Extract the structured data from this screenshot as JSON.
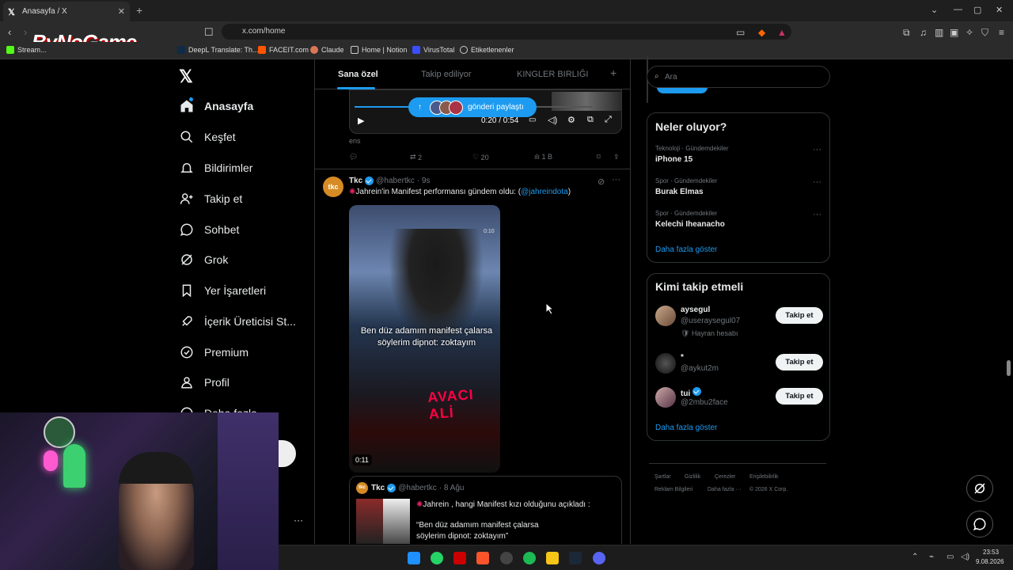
{
  "browser": {
    "tab_title": "Anasayfa / X",
    "url": "x.com/home",
    "bookmarks": [
      "Stream...",
      "DeepL Translate: Th...",
      "FACEIT.com",
      "Claude",
      "Home | Notion",
      "VirusTotal",
      "Etiketlenenler"
    ],
    "watermark": "ByNoGame"
  },
  "sidebar": {
    "items": [
      {
        "label": "Anasayfa",
        "icon": "home-icon"
      },
      {
        "label": "Keşfet",
        "icon": "search-icon"
      },
      {
        "label": "Bildirimler",
        "icon": "bell-icon"
      },
      {
        "label": "Takip et",
        "icon": "person-add-icon"
      },
      {
        "label": "Sohbet",
        "icon": "chat-icon"
      },
      {
        "label": "Grok",
        "icon": "grok-icon"
      },
      {
        "label": "Yer İşaretleri",
        "icon": "bookmark-icon"
      },
      {
        "label": "İçerik Üreticisi St...",
        "icon": "rocket-icon"
      },
      {
        "label": "Premium",
        "icon": "premium-icon"
      },
      {
        "label": "Profil",
        "icon": "profile-icon"
      },
      {
        "label": "Daha fazla",
        "icon": "more-icon"
      }
    ]
  },
  "feed": {
    "tabs": [
      "Sana özel",
      "Takip ediliyor",
      "KINGLER BIRLIĞI"
    ],
    "share_pill": "gönderi paylaştı",
    "video1_time": "0:20 / 0:54",
    "video1_caption": "ens",
    "video1_stats": {
      "reply": "",
      "retweet": "2",
      "like": "20",
      "views": "1 B"
    },
    "tweet": {
      "name": "Tkc",
      "handle": "@habertkc",
      "time": "· 9s",
      "text_prefix": "Jahrein'in Manifest performansı gündem oldu: (",
      "mention": "@jahreindota",
      "text_suffix": ")",
      "video_overlay_text": "Ben düz adamım manifest çalarsa söylerim dipnot: zoktayım",
      "video_corner_time": "0:10",
      "video_duration": "0:11",
      "video_sign": "AVACI ALİ"
    },
    "quote": {
      "name": "Tkc",
      "handle": "@habertkc",
      "time": "· 8 Ağu",
      "line1": "Jahrein , hangi Manifest kızı olduğunu açıkladı :",
      "line2": "“Ben düz adamım manifest çalarsa",
      "line3": "söylerim dipnot: zoktayım”"
    }
  },
  "right": {
    "search_placeholder": "Ara",
    "trends_title": "Neler oluyor?",
    "trends": [
      {
        "category": "Teknoloji · Gündemdekiler",
        "name": "iPhone 15"
      },
      {
        "category": "Spor · Gündemdekiler",
        "name": "Burak Elmas"
      },
      {
        "category": "Spor · Gündemdekiler",
        "name": "Kelechi Iheanacho"
      }
    ],
    "trends_more": "Daha fazla göster",
    "follow_title": "Kimi takip etmeli",
    "follow": [
      {
        "name": "aysegul",
        "handle": "@useraysegul07",
        "note": "Hayran hesabı",
        "button": "Takip et",
        "verified": false
      },
      {
        "name": "*",
        "handle": "@aykut2m",
        "note": "",
        "button": "Takip et",
        "verified": false
      },
      {
        "name": "tui",
        "handle": "@2mbu2face",
        "note": "",
        "button": "Takip et",
        "verified": true
      }
    ],
    "follow_more": "Daha fazla göster",
    "footer": [
      "Şartlar",
      "Gizlilik",
      "Çerezler",
      "Erişilebilirlik",
      "Reklam Bilgileri",
      "Daha fazla ···",
      "© 2026 X Corp."
    ]
  },
  "taskbar": {
    "time": "23:53",
    "date": "9.08.2026"
  },
  "colors": {
    "accent": "#1d9bf0",
    "background": "#000000",
    "muted": "#71767b"
  }
}
